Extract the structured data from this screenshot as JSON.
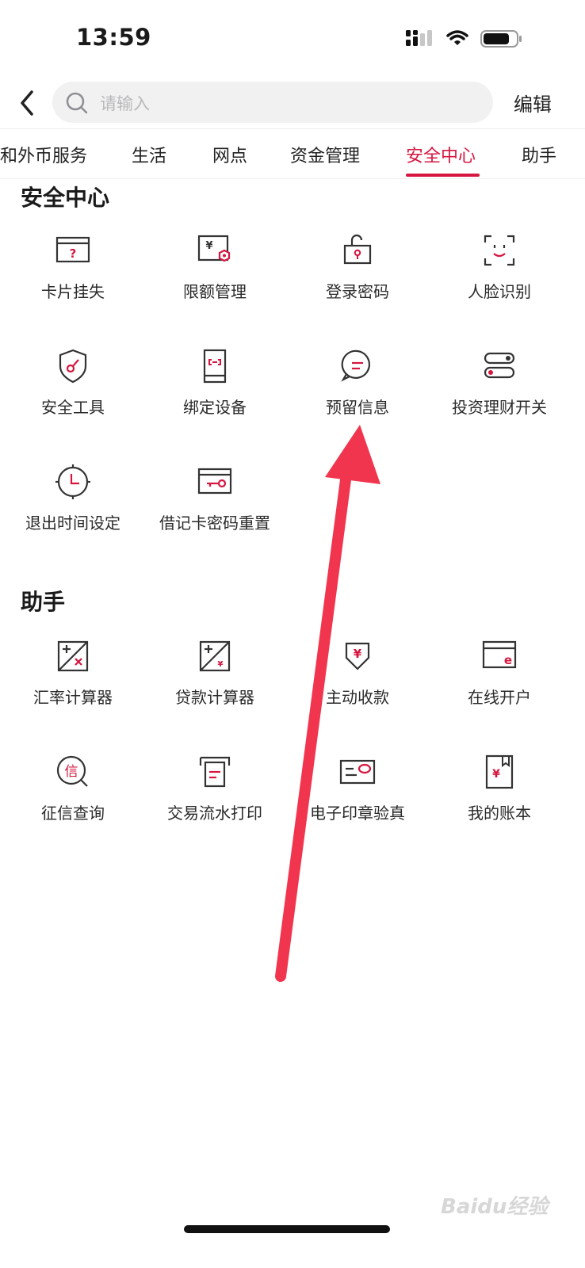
{
  "status_bar": {
    "time": "13:59"
  },
  "search": {
    "placeholder": "请输入",
    "edit_label": "编辑"
  },
  "tabs": [
    {
      "label": "和外币服务",
      "active": false
    },
    {
      "label": "生活",
      "active": false
    },
    {
      "label": "网点",
      "active": false
    },
    {
      "label": "资金管理",
      "active": false
    },
    {
      "label": "安全中心",
      "active": true
    },
    {
      "label": "助手",
      "active": false
    }
  ],
  "sections": {
    "security": {
      "title": "安全中心",
      "items": [
        {
          "label": "卡片挂失",
          "icon": "card-question-icon"
        },
        {
          "label": "限额管理",
          "icon": "limit-icon"
        },
        {
          "label": "登录密码",
          "icon": "lock-icon"
        },
        {
          "label": "人脸识别",
          "icon": "face-scan-icon"
        },
        {
          "label": "安全工具",
          "icon": "shield-key-icon"
        },
        {
          "label": "绑定设备",
          "icon": "phone-link-icon"
        },
        {
          "label": "预留信息",
          "icon": "message-icon"
        },
        {
          "label": "投资理财开关",
          "icon": "toggle-icon"
        },
        {
          "label": "退出时间设定",
          "icon": "clock-icon"
        },
        {
          "label": "借记卡密码重置",
          "icon": "card-key-icon"
        }
      ]
    },
    "assistant": {
      "title": "助手",
      "items": [
        {
          "label": "汇率计算器",
          "icon": "exchange-calculator-icon"
        },
        {
          "label": "贷款计算器",
          "icon": "loan-calculator-icon"
        },
        {
          "label": "主动收款",
          "icon": "receive-money-icon"
        },
        {
          "label": "在线开户",
          "icon": "online-account-icon"
        },
        {
          "label": "征信查询",
          "icon": "credit-query-icon",
          "glyph": "信"
        },
        {
          "label": "交易流水打印",
          "icon": "print-icon"
        },
        {
          "label": "电子印章验真",
          "icon": "seal-verify-icon"
        },
        {
          "label": "我的账本",
          "icon": "ledger-icon"
        }
      ]
    }
  },
  "watermark": "Baidu经验",
  "colors": {
    "accent": "#d6163f",
    "arrow": "#f2354e",
    "text": "#222222"
  }
}
